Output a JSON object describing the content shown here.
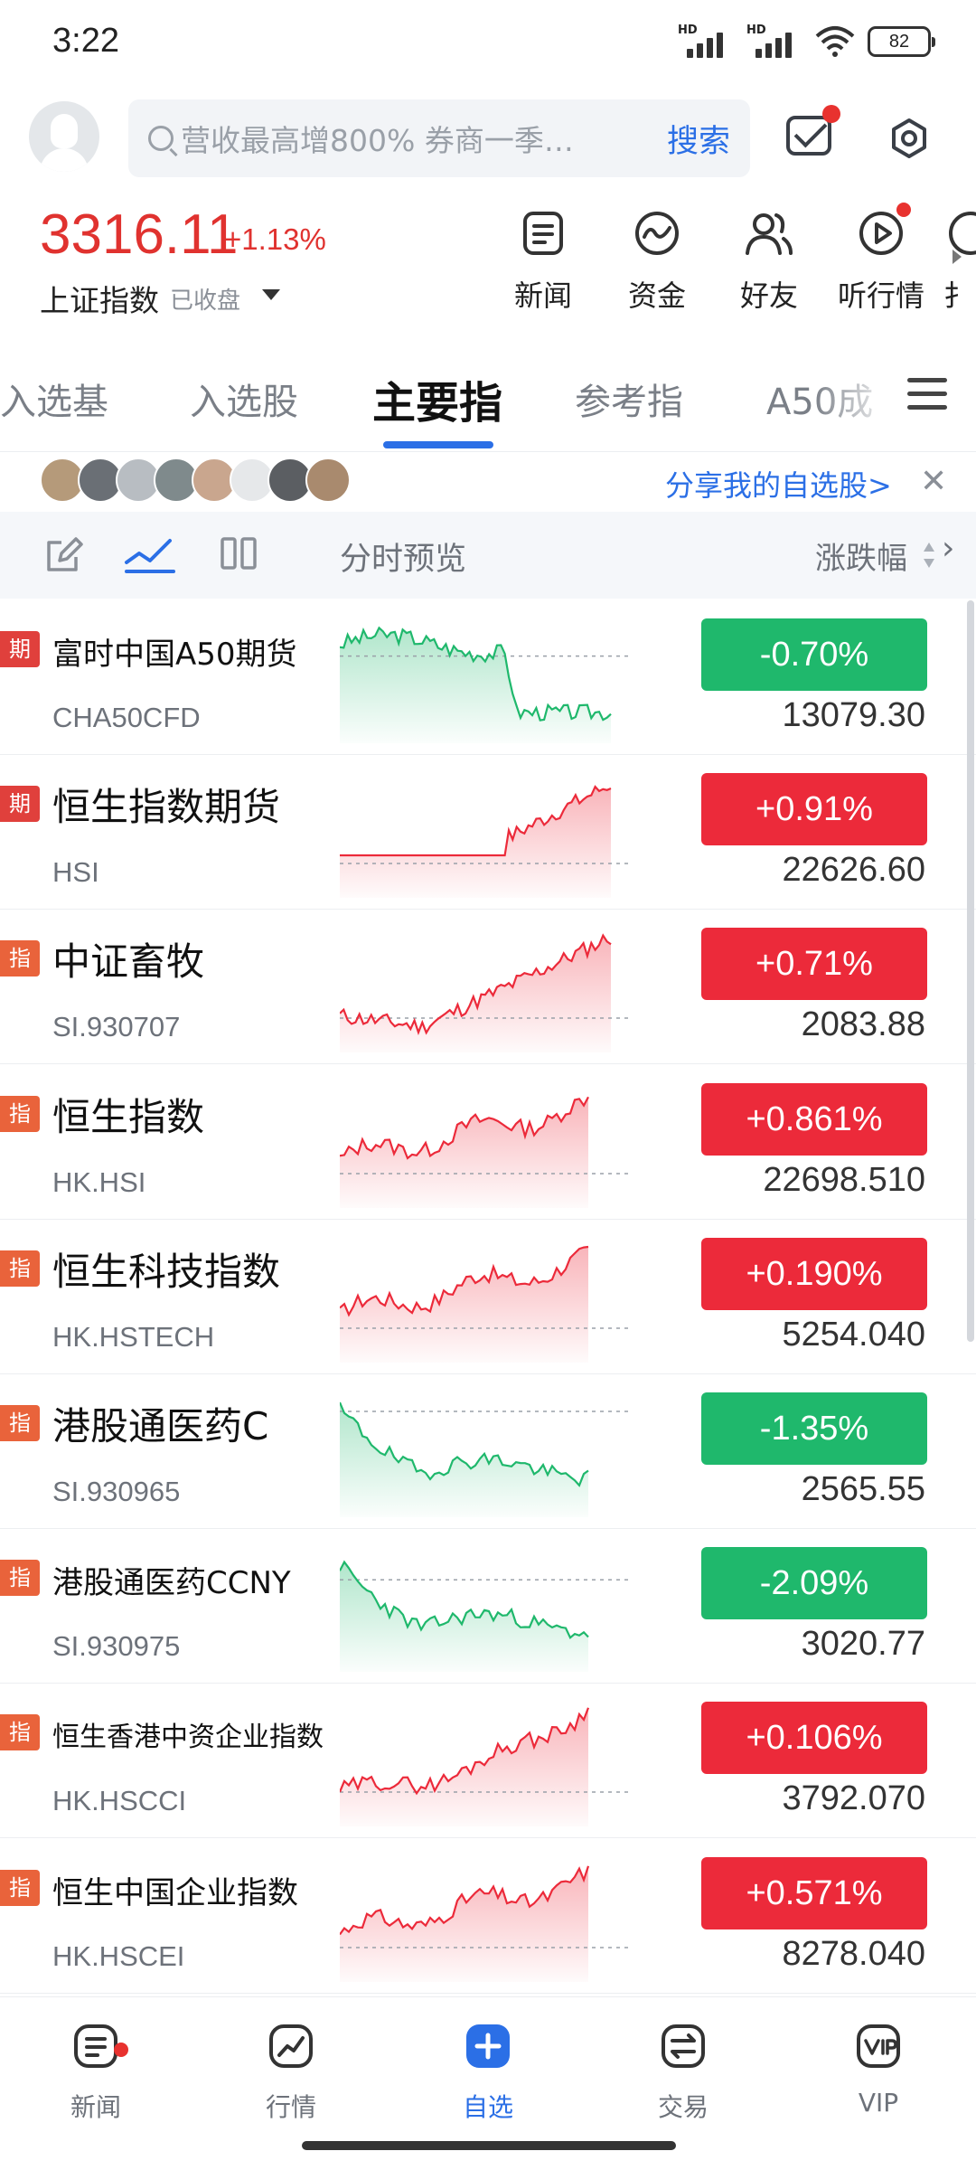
{
  "status_bar": {
    "time": "3:22",
    "signal1_label": "HD",
    "signal2_label": "HD",
    "battery": "82"
  },
  "header": {
    "search_placeholder": "营收最高增800% 券商一季…",
    "search_button": "搜索"
  },
  "index": {
    "value": "3316.11",
    "change": "+1.13%",
    "name": "上证指数",
    "state": "已收盘"
  },
  "quick_actions": [
    {
      "label": "新闻",
      "icon": "news-icon"
    },
    {
      "label": "资金",
      "icon": "money-icon"
    },
    {
      "label": "好友",
      "icon": "friends-icon"
    },
    {
      "label": "听行情",
      "icon": "play-icon"
    },
    {
      "label": "扌",
      "icon": "partial-icon"
    }
  ],
  "tabs": [
    "入选基",
    "入选股",
    "主要指",
    "参考指",
    "A50成"
  ],
  "active_tab": 2,
  "share": {
    "text": "分享我的自选股>",
    "avatar_colors": [
      "#b59a7a",
      "#6a6f75",
      "#b8bdc2",
      "#7f8a8c",
      "#c9a68e",
      "#e6e8ea",
      "#5b5e62",
      "#a98a6e"
    ]
  },
  "toolbar": {
    "preview_label": "分时预览",
    "sort_label": "涨跌幅"
  },
  "colors": {
    "up": "#ec2a3a",
    "down": "#1fb86c",
    "accent": "#2b6fe6"
  },
  "rows": [
    {
      "badge": "期",
      "name": "富时中国A50期货",
      "code": "CHA50CFD",
      "change": "-0.70%",
      "price": "13079.30",
      "dir": "down"
    },
    {
      "badge": "期",
      "name": "恒生指数期货",
      "code": "HSI",
      "change": "+0.91%",
      "price": "22626.60",
      "dir": "up"
    },
    {
      "badge": "指",
      "name": "中证畜牧",
      "code": "SI.930707",
      "change": "+0.71%",
      "price": "2083.88",
      "dir": "up"
    },
    {
      "badge": "指",
      "name": "恒生指数",
      "code": "HK.HSI",
      "change": "+0.861%",
      "price": "22698.510",
      "dir": "up"
    },
    {
      "badge": "指",
      "name": "恒生科技指数",
      "code": "HK.HSTECH",
      "change": "+0.190%",
      "price": "5254.040",
      "dir": "up"
    },
    {
      "badge": "指",
      "name": "港股通医药C",
      "code": "SI.930965",
      "change": "-1.35%",
      "price": "2565.55",
      "dir": "down"
    },
    {
      "badge": "指",
      "name": "港股通医药CCNY",
      "code": "SI.930975",
      "change": "-2.09%",
      "price": "3020.77",
      "dir": "down"
    },
    {
      "badge": "指",
      "name": "恒生香港中资企业指数",
      "code": "HK.HSCCI",
      "change": "+0.106%",
      "price": "3792.070",
      "dir": "up"
    },
    {
      "badge": "指",
      "name": "恒生中国企业指数",
      "code": "HK.HSCEI",
      "change": "+0.571%",
      "price": "8278.040",
      "dir": "up"
    }
  ],
  "bottom_nav": [
    {
      "label": "新闻",
      "icon": "news-icon"
    },
    {
      "label": "行情",
      "icon": "market-icon"
    },
    {
      "label": "自选",
      "icon": "plus-icon"
    },
    {
      "label": "交易",
      "icon": "trade-icon"
    },
    {
      "label": "VIP",
      "icon": "vip-icon"
    }
  ]
}
